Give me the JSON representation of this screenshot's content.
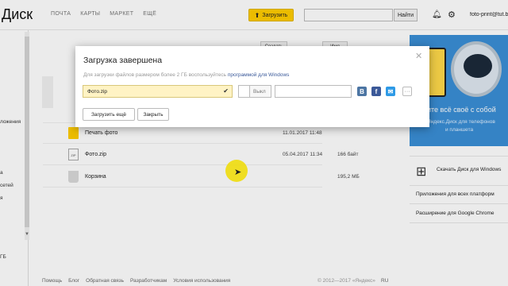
{
  "header": {
    "logo": "Диск",
    "nav": [
      "ПОЧТА",
      "КАРТЫ",
      "МАРКЕТ",
      "ЕЩЁ"
    ],
    "upload_label": "Загрузить",
    "search_value": "",
    "find_label": "Найти",
    "user_email": "foto-print@tut.by"
  },
  "sidebar": {
    "items": [
      "",
      "ложения",
      "",
      "",
      "",
      "а",
      "сетей",
      "я",
      ""
    ],
    "space": "ГБ"
  },
  "toolbar": {
    "create_label": "Создать",
    "sort_label": "Имя"
  },
  "files": [
    {
      "name": "Печать фото",
      "date": "11.01.2017 11:48",
      "size": "",
      "icon": "folder-icon"
    },
    {
      "name": "Фото.zip",
      "date": "05.04.2017 11:34",
      "size": "166 байт",
      "icon": "zip-icon"
    },
    {
      "name": "Корзина",
      "date": "",
      "size": "195,2 МБ",
      "icon": "trash-icon"
    }
  ],
  "promo": {
    "line1": "Носите всё своё с собой",
    "line2": "Яндекс.Диск для телефонов",
    "line3": "и планшета"
  },
  "right_panel": {
    "download_label": "Скачать Диск для Windows",
    "apps_label": "Приложения для всех платформ",
    "chrome_label": "Расширение для Google Chrome"
  },
  "footer": {
    "links": [
      "Помощь",
      "Блог",
      "Обратная связь",
      "Разработчикам",
      "Условия использования"
    ],
    "copyright": "© 2012—2017 «Яндекс»",
    "lang": "RU"
  },
  "dialog": {
    "title": "Загрузка завершена",
    "hint": "Для загрузки файлов размером более 2 ГБ воспользуйтесь",
    "hint_link": "программой для Windows",
    "file_name": "Фото.zip",
    "toggle_label": "Выкл",
    "share_link_value": "",
    "share_vk": "В",
    "share_fb": "f",
    "share_mail": "✉",
    "share_more": "···",
    "upload_more_label": "Загрузить ещё",
    "close_label": "Закрыть"
  }
}
